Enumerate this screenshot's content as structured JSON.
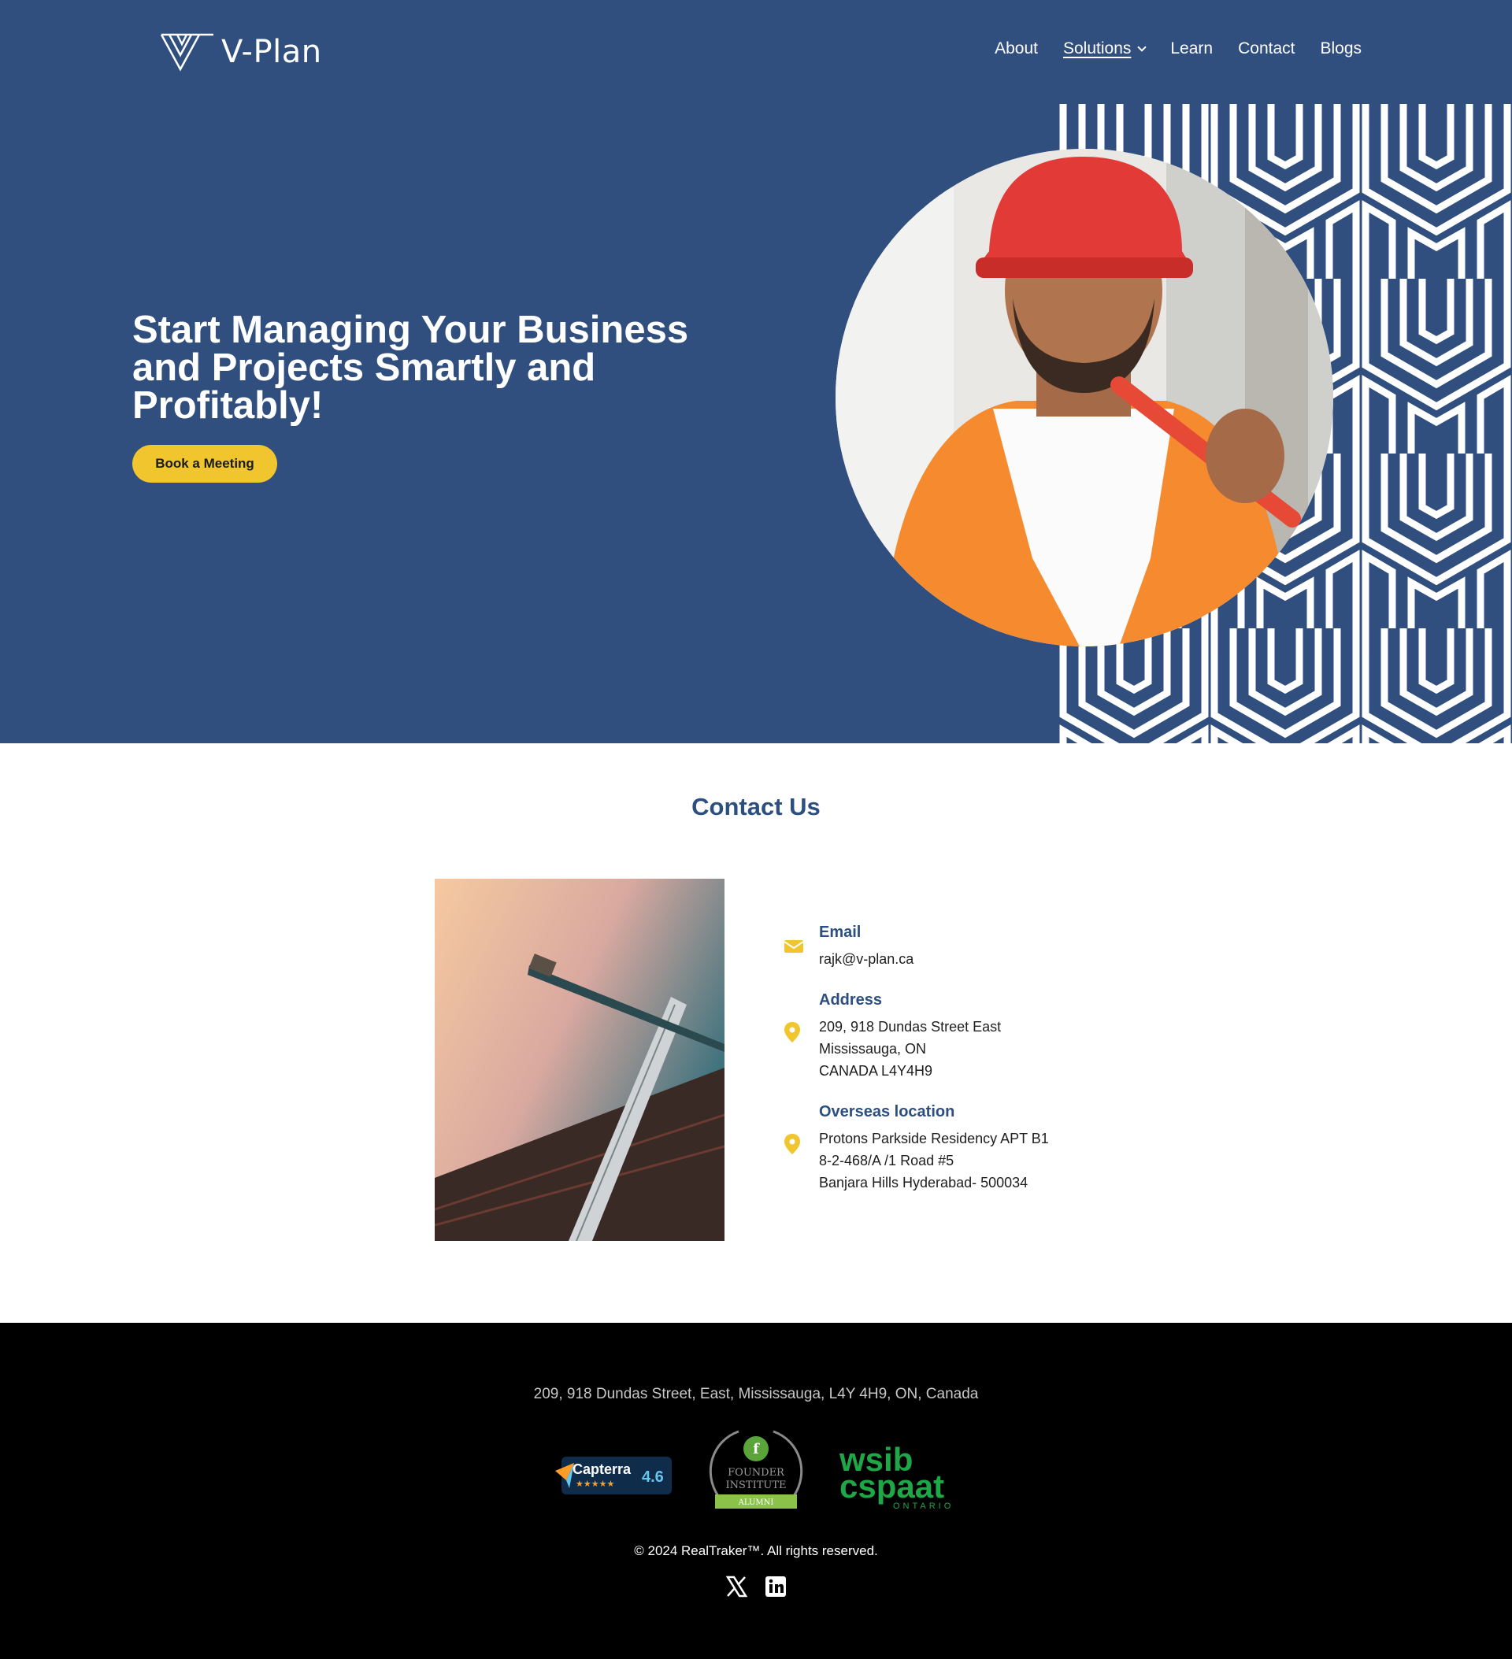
{
  "brand": {
    "name": "V-Plan"
  },
  "nav": {
    "items": [
      {
        "label": "About"
      },
      {
        "label": "Solutions"
      },
      {
        "label": "Learn"
      },
      {
        "label": "Contact"
      },
      {
        "label": "Blogs"
      }
    ]
  },
  "hero": {
    "title": "Start Managing Your Business and Projects Smartly and Profitably!",
    "cta_label": "Book a Meeting"
  },
  "contact": {
    "title": "Contact Us",
    "email": {
      "label": "Email",
      "value": "rajk@v-plan.ca",
      "icon": "envelope-icon"
    },
    "address": {
      "label": "Address",
      "icon": "map-pin-icon",
      "lines": [
        "209, 918 Dundas Street East",
        "Mississauga, ON",
        "CANADA L4Y4H9"
      ]
    },
    "overseas": {
      "label": "Overseas location",
      "icon": "map-pin-icon",
      "lines": [
        "Protons Parkside Residency APT B1",
        "8-2-468/A /1 Road #5",
        "Banjara Hills Hyderabad- 500034"
      ]
    }
  },
  "footer": {
    "address": "209, 918 Dundas Street, East, Mississauga, L4Y 4H9, ON, Canada",
    "badges": {
      "capterra": {
        "name": "Capterra",
        "rating": "4.6"
      },
      "founder": {
        "line1": "FOUNDER",
        "line2": "INSTITUTE",
        "ribbon": "ALUMNI"
      },
      "wsib": {
        "line1": "wsib",
        "line2": "cspaat",
        "line3": "ONTARIO"
      }
    },
    "copyright": "© 2024 RealTraker™. All rights reserved.",
    "socials": [
      "x-icon",
      "linkedin-icon"
    ]
  },
  "colors": {
    "hero_bg": "#304f7f",
    "accent_yellow": "#f0c52e",
    "heading_blue": "#2c4f80",
    "footer_bg": "#000000"
  }
}
